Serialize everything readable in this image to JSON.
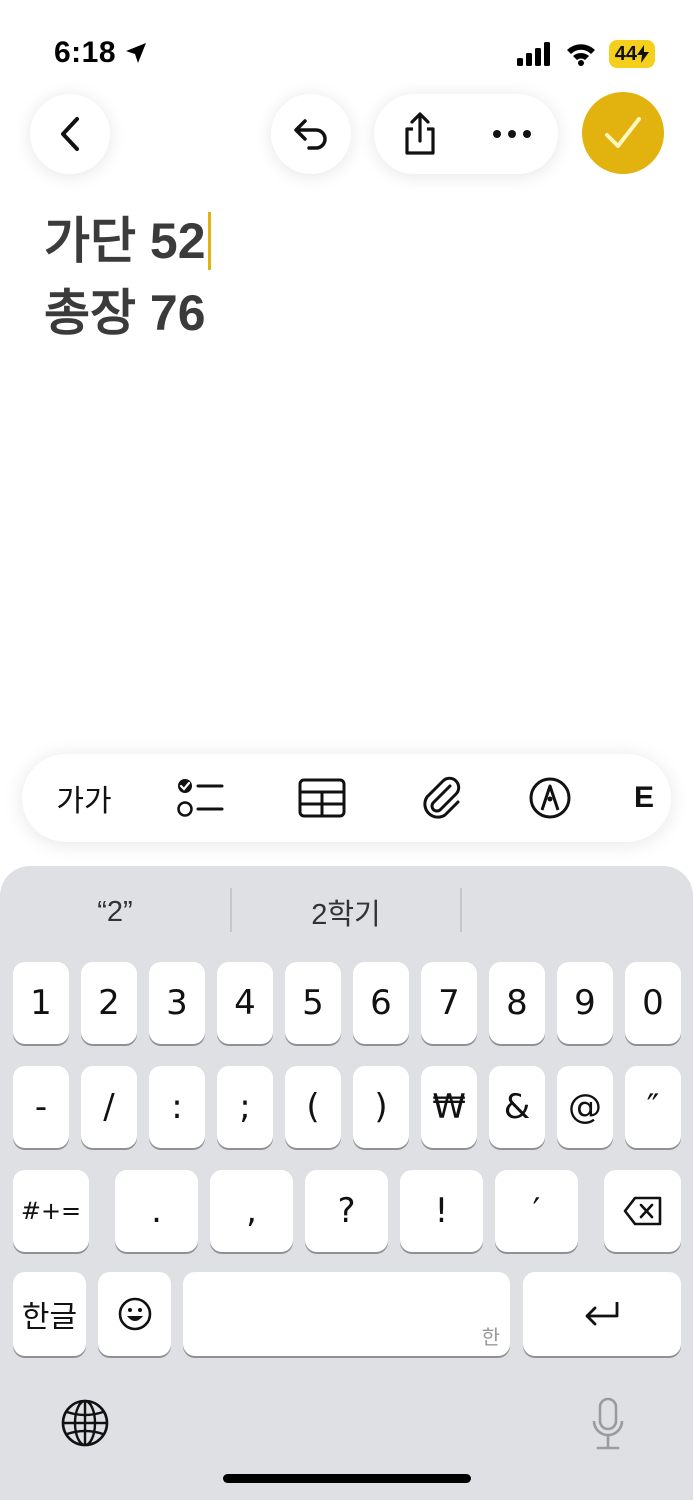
{
  "status": {
    "time": "6:18",
    "battery": "44"
  },
  "note": {
    "lines": [
      "가단 52",
      "총장 76"
    ]
  },
  "format_bar": {
    "text_style_label": "가가",
    "partial_label": "E"
  },
  "suggestions": [
    "“2”",
    "2학기",
    ""
  ],
  "keyboard": {
    "row1": [
      "1",
      "2",
      "3",
      "4",
      "5",
      "6",
      "7",
      "8",
      "9",
      "0"
    ],
    "row2": [
      "-",
      "/",
      ":",
      ";",
      "(",
      ")",
      "₩",
      "&",
      "@",
      "″"
    ],
    "row3": [
      "#+=",
      ".",
      ",",
      "?",
      "!",
      "′"
    ],
    "lang_key": "한글",
    "space_hint": "한"
  },
  "colors": {
    "accent": "#e2b20f",
    "battery": "#f4cf1c",
    "keyboard_bg": "#dfe0e4"
  },
  "icons": [
    "back-arrow-icon",
    "undo-icon",
    "share-icon",
    "more-icon",
    "checkmark-icon",
    "checklist-icon",
    "table-icon",
    "paperclip-icon",
    "markup-pen-icon",
    "delete-icon",
    "emoji-icon",
    "return-icon",
    "globe-icon",
    "microphone-icon"
  ]
}
